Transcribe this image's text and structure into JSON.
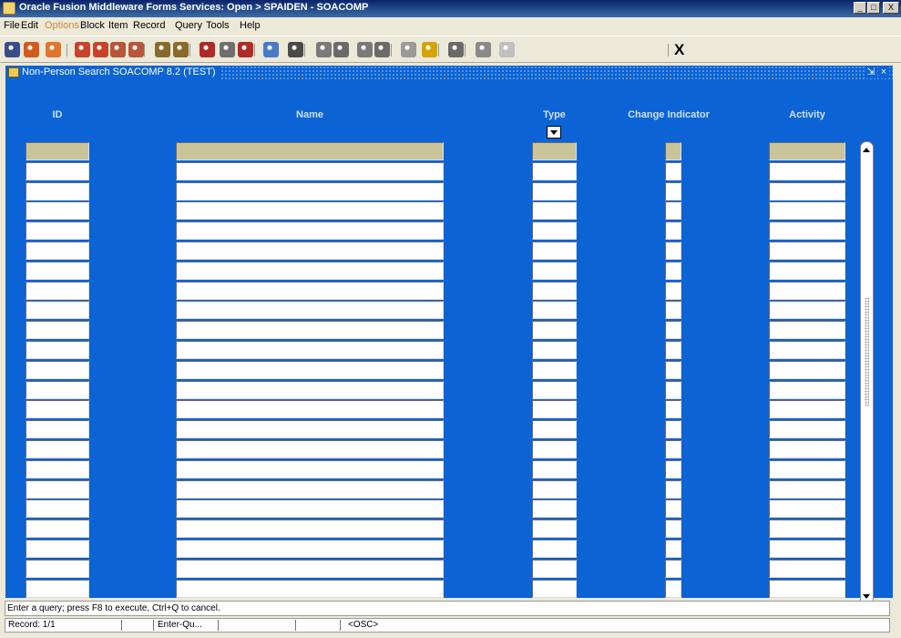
{
  "window": {
    "title": "Oracle Fusion Middleware Forms Services: Open > SPAIDEN - SOACOMP",
    "minimize": "_",
    "maximize": "□",
    "close": "X"
  },
  "menu": [
    {
      "label": "File",
      "enabled": true
    },
    {
      "label": "Edit",
      "enabled": true
    },
    {
      "label": "Options",
      "enabled": false
    },
    {
      "label": "Block",
      "enabled": true
    },
    {
      "label": "Item",
      "enabled": true
    },
    {
      "label": "Record",
      "enabled": true
    },
    {
      "label": "Query",
      "enabled": true
    },
    {
      "label": "Tools",
      "enabled": true
    },
    {
      "label": "Help",
      "enabled": true
    }
  ],
  "toolbar": {
    "icons": [
      "save-icon",
      "rollback-icon",
      "print-icon",
      "insert-record-icon",
      "remove-record-icon",
      "previous-block-icon",
      "next-block-icon",
      "previous-record-icon",
      "next-record-icon",
      "enter-query-icon",
      "execute-query-icon",
      "cancel-query-icon",
      "options-icon",
      "print-page-icon",
      "search-icon",
      "expand-icon",
      "lov-icon",
      "calendar-icon",
      "sound-icon",
      "help-hub-icon",
      "attachments-icon",
      "help-icon",
      "hint-icon"
    ],
    "exit_label": "X"
  },
  "form": {
    "title": "Non-Person Search  SOACOMP  8.2  (TEST)",
    "maximize": "⇲",
    "close": "×"
  },
  "columns": {
    "id": "ID",
    "name": "Name",
    "type": "Type",
    "change_indicator": "Change Indicator",
    "activity": "Activity"
  },
  "row_count": 23,
  "status": {
    "message": "Enter a query;  press F8 to execute, Ctrl+Q to cancel.",
    "record": "Record: 1/1",
    "cell2": "",
    "mode": "Enter-Qu...",
    "cell4": "",
    "cell5": "",
    "osc": "<OSC>"
  }
}
